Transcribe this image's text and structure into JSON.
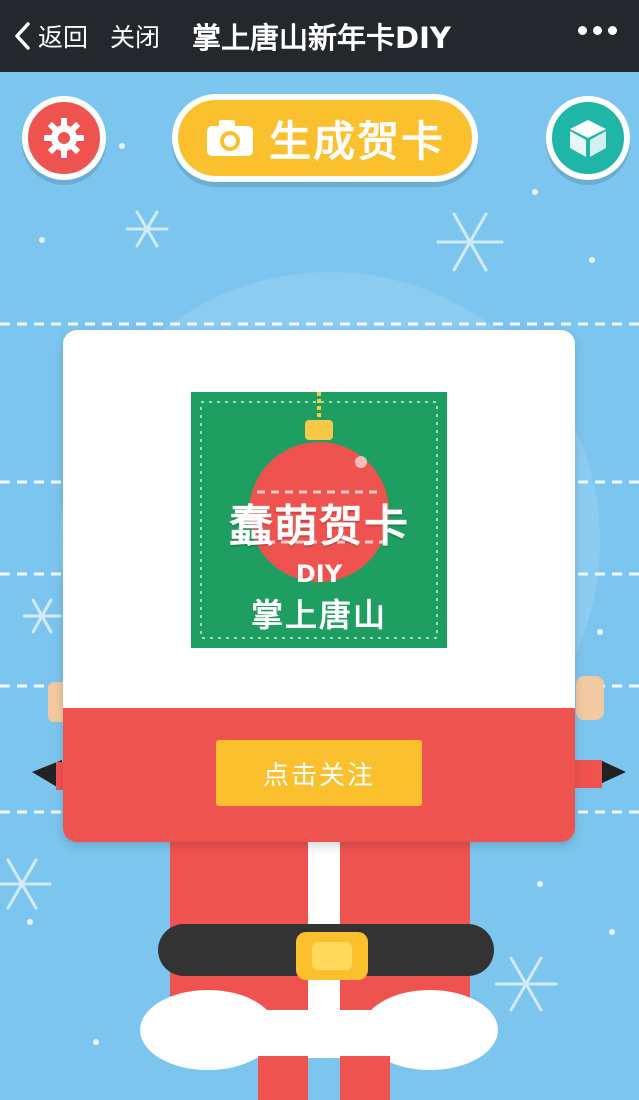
{
  "topbar": {
    "back_label": "返回",
    "close_label": "关闭",
    "title": "掌上唐山新年卡DIY",
    "more_icon": "more-dots-icon"
  },
  "toolbar": {
    "settings_icon": "gear-icon",
    "generate_label": "生成贺卡",
    "generate_icon": "camera-icon",
    "cube_icon": "cube-icon"
  },
  "card": {
    "qr_title": "蠢萌贺卡",
    "qr_sub": "DIY",
    "qr_brand": "掌上唐山",
    "follow_label": "点击关注"
  },
  "colors": {
    "background": "#7cc5ee",
    "accent_red": "#ef5350",
    "accent_yellow": "#fbc02d",
    "accent_teal": "#1fb5a7",
    "card_green": "#1e9e60"
  }
}
